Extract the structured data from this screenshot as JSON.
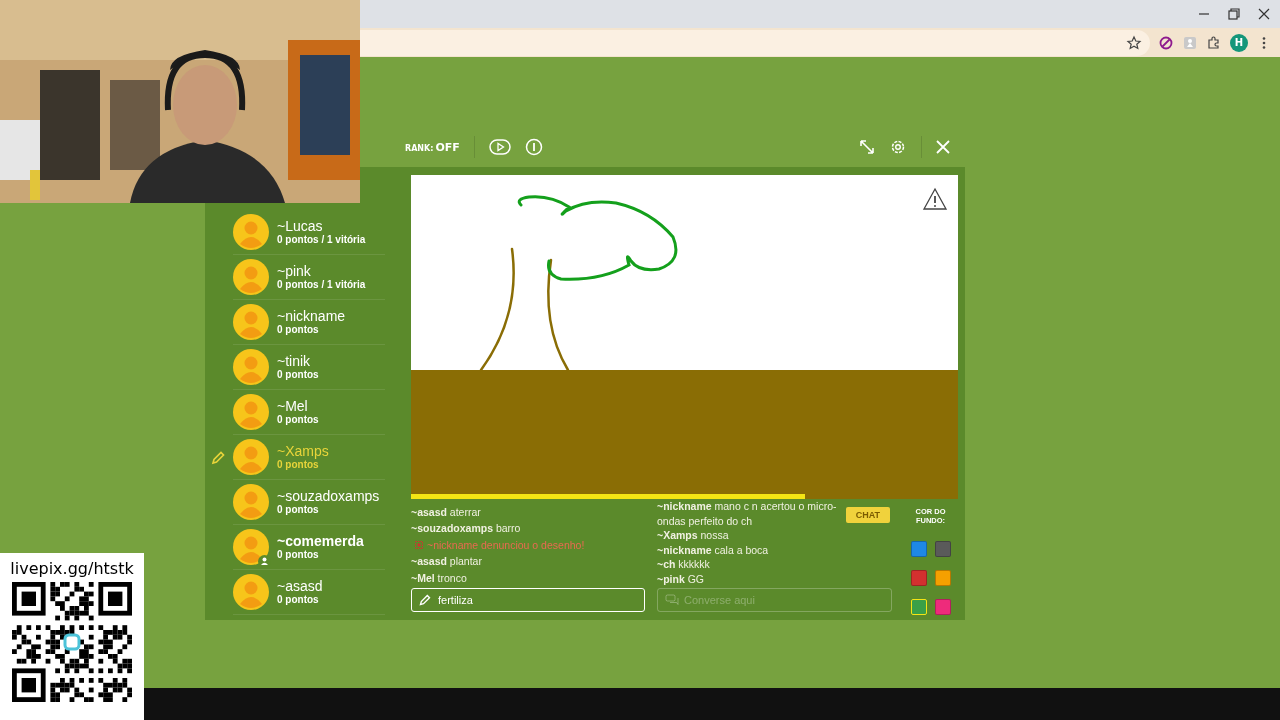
{
  "browser": {
    "profile_initial": "H"
  },
  "overlay": {
    "donation_link": "livepix.gg/htstk"
  },
  "toolbar": {
    "rank_label": "RANK:",
    "rank_value": "OFF"
  },
  "players": [
    {
      "name": "~Lucas",
      "score": "0 pontos / 1 vitória",
      "drawing": false,
      "me": false
    },
    {
      "name": "~pink",
      "score": "0 pontos / 1 vitória",
      "drawing": false,
      "me": false
    },
    {
      "name": "~nickname",
      "score": "0 pontos",
      "drawing": false,
      "me": false
    },
    {
      "name": "~tinik",
      "score": "0 pontos",
      "drawing": false,
      "me": false
    },
    {
      "name": "~Mel",
      "score": "0 pontos",
      "drawing": false,
      "me": false
    },
    {
      "name": "~Xamps",
      "score": "0 pontos",
      "drawing": true,
      "me": false
    },
    {
      "name": "~souzadoxamps",
      "score": "0 pontos",
      "drawing": false,
      "me": false
    },
    {
      "name": "~comemerda",
      "score": "0 pontos",
      "drawing": false,
      "me": true
    },
    {
      "name": "~asasd",
      "score": "0 pontos",
      "drawing": false,
      "me": false
    }
  ],
  "timer": {
    "level": 0.72
  },
  "answers": {
    "messages": [
      {
        "kind": "guess",
        "user": "~asasd",
        "text": "aterrar"
      },
      {
        "kind": "guess",
        "user": "~souzadoxamps",
        "text": "barro"
      },
      {
        "kind": "alert",
        "text": "~nickname denunciou o desenho!"
      },
      {
        "kind": "guess",
        "user": "~asasd",
        "text": "plantar"
      },
      {
        "kind": "guess",
        "user": "~Mel",
        "text": "tronco"
      }
    ],
    "input": {
      "value": "fertiliza"
    }
  },
  "chat": {
    "badge": "CHAT",
    "messages": [
      {
        "user": "~nickname",
        "text": "mano c n acertou o micro-ondas perfeito do ch"
      },
      {
        "user": "~Xamps",
        "text": "nossa"
      },
      {
        "user": "~nickname",
        "text": "cala a boca"
      },
      {
        "user": "~ch",
        "text": "kkkkkk"
      },
      {
        "user": "~pink",
        "text": "GG"
      }
    ],
    "input": {
      "placeholder": "Converse aqui"
    }
  },
  "background_colors": {
    "label": "COR DO FUNDO:",
    "swatches": [
      {
        "color": "#1e88e5",
        "selected": false
      },
      {
        "color": "#5a5a5a",
        "selected": false
      },
      {
        "color": "#d3302f",
        "selected": false
      },
      {
        "color": "#f5a000",
        "selected": false
      },
      {
        "color": "#3aa047",
        "selected": true
      },
      {
        "color": "#ee2b7b",
        "selected": false
      }
    ]
  }
}
